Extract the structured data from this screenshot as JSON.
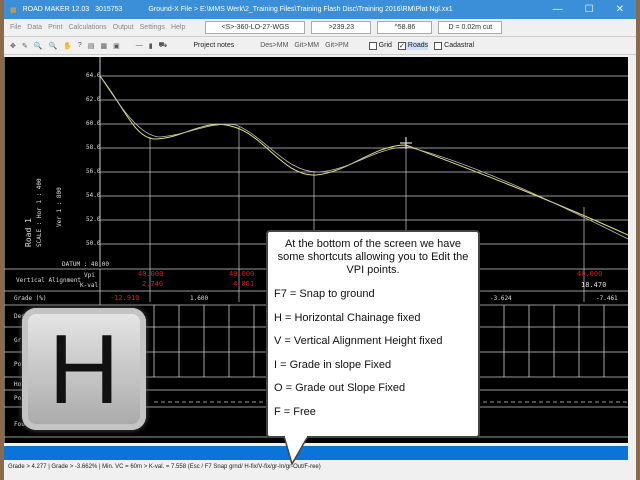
{
  "window": {
    "app": "ROAD MAKER 12.03",
    "build": "3015753",
    "file": "Ground-X File > E:\\MMS Werk\\2_Training Files\\Training Flash Disc\\Training 2016\\RM\\Plat Ngl.xx1",
    "minimize": "—",
    "maximize": "☐",
    "close": "✕"
  },
  "menu": [
    "File",
    "Data",
    "Print",
    "Calculations",
    "Output",
    "Settings",
    "Help"
  ],
  "fields": [
    "<S>-360-LO-27-WGS",
    ">239.23",
    "^58.86",
    "D = 0.02m cut"
  ],
  "toolbar2": {
    "project_notes": "Project notes",
    "des_mm": "Des>MM",
    "git_mm": "Git>MM",
    "git_pm": "Git>PM",
    "grid": "Grid",
    "roads": "Roads",
    "cadastral": "Cadastral",
    "grid_checked": false,
    "roads_checked": true,
    "cadastral_checked": false
  },
  "profile": {
    "y_labels": [
      "64.0",
      "62.0",
      "60.0",
      "58.0",
      "56.0",
      "54.0",
      "52.0",
      "50.0"
    ],
    "datum": "DATUM : 48.00",
    "road": "Road 1",
    "scale": "SCALE : Hor 1 : 400",
    "ver": "Ver 1 : 800"
  },
  "rows": {
    "vertical_alignment": "Vertical Alignment",
    "vpi": "Vpi",
    "kval": "K-val",
    "grade": "Grade (%)",
    "grade_values": [
      "-12.910",
      "1.600",
      "-3.624",
      "-7.461"
    ],
    "vpis": [
      {
        "vpi": "40.000",
        "k": "2.740"
      },
      {
        "vpi": "40.000",
        "k": "4.061"
      },
      {
        "vpi": "40.000",
        "k": "18.470"
      }
    ],
    "left_labels": [
      "Des",
      "Gr",
      "Po",
      "Ho",
      "Po",
      "Four"
    ]
  },
  "callout": {
    "intro": "At the bottom of the screen we have some shortcuts allowing you to Edit the VPI points.",
    "lines": [
      "F7 = Snap to ground",
      "H = Horizontal Chainage fixed",
      "V = Vertical Alignment Height fixed",
      "I = Grade in slope Fixed",
      "O = Grade out Slope Fixed",
      "F = Free"
    ]
  },
  "key": "H",
  "status": "Grade >   4.277 | Grade >   -3.662% | Min. VC = 60m > K-val. =   7.558 (Esc / F7 Snap grnd/ H-fix/V-fix/gr-In/gr-Out/F-ree)",
  "colors": {
    "titlebar": "#3a8fd8",
    "canvas": "#000000",
    "vpi_red": "#d02020",
    "status_bar": "#0a74d8"
  }
}
